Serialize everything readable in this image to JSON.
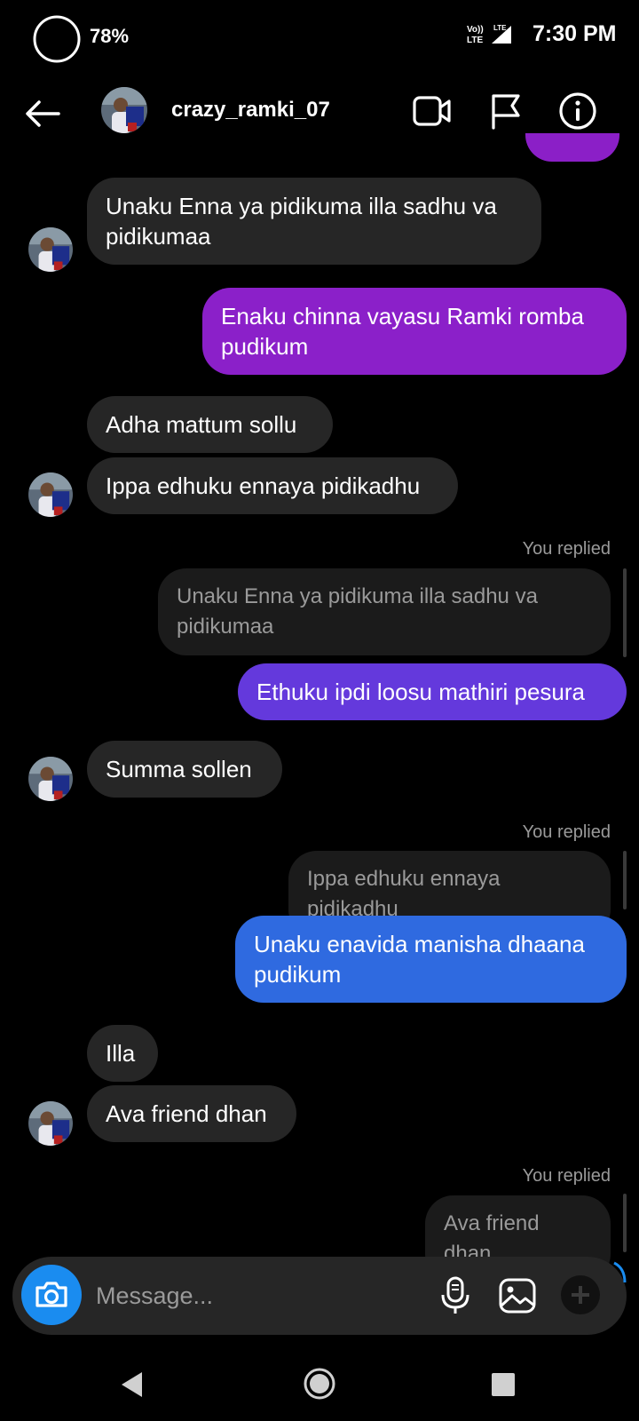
{
  "status_bar": {
    "battery_percent": "78%",
    "network": "Vo)) LTE",
    "time": "7:30 PM"
  },
  "header": {
    "username": "crazy_ramki_07",
    "icons": [
      "back-arrow-icon",
      "video-call-icon",
      "flag-icon",
      "info-icon"
    ]
  },
  "messages": [
    {
      "side": "incoming",
      "text": "Unaku Enna ya pidikuma illa sadhu va pidikumaa"
    },
    {
      "side": "outgoing",
      "text": "Enaku chinna vayasu Ramki romba pudikum"
    },
    {
      "side": "incoming",
      "text": "Adha mattum sollu"
    },
    {
      "side": "incoming",
      "text": "Ippa edhuku ennaya pidikadhu"
    },
    {
      "side": "outgoing",
      "replied_label": "You replied",
      "quote": "Unaku Enna ya pidikuma illa sadhu va pidikumaa",
      "text": "Ethuku ipdi loosu mathiri pesura"
    },
    {
      "side": "incoming",
      "text": "Summa sollen"
    },
    {
      "side": "outgoing",
      "replied_label": "You replied",
      "quote": "Ippa edhuku ennaya pidikadhu",
      "text": "Unaku enavida manisha dhaana pudikum"
    },
    {
      "side": "incoming",
      "text": "Illa"
    },
    {
      "side": "incoming",
      "text": "Ava friend dhan"
    },
    {
      "side": "outgoing",
      "replied_label": "You replied",
      "quote": "Ava friend dhan"
    }
  ],
  "composer": {
    "placeholder": "Message...",
    "icons": [
      "camera-icon",
      "microphone-icon",
      "gallery-icon",
      "plus-icon"
    ]
  },
  "colors": {
    "bubble_incoming": "#262626",
    "bubble_out_1": "#8b20c9",
    "bubble_out_2": "#6439dc",
    "bubble_out_3": "#2f6ae0",
    "camera_button": "#1a8cf0"
  }
}
